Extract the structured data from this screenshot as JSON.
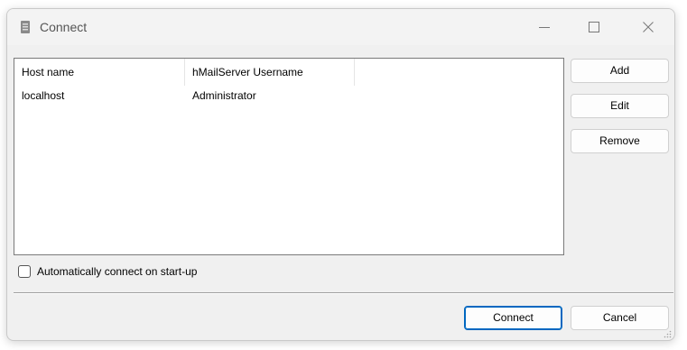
{
  "window": {
    "title": "Connect",
    "icon": "server-icon",
    "controls": [
      "minimize-icon",
      "maximize-icon",
      "close-icon"
    ]
  },
  "list": {
    "columns": [
      "Host name",
      "hMailServer Username"
    ],
    "rows": [
      {
        "host": "localhost",
        "username": "Administrator"
      }
    ]
  },
  "buttons": {
    "add": "Add",
    "edit": "Edit",
    "remove": "Remove",
    "connect": "Connect",
    "cancel": "Cancel"
  },
  "auto_connect": {
    "label": "Automatically connect on start-up",
    "checked": false
  },
  "colors": {
    "accent": "#0067c0"
  }
}
